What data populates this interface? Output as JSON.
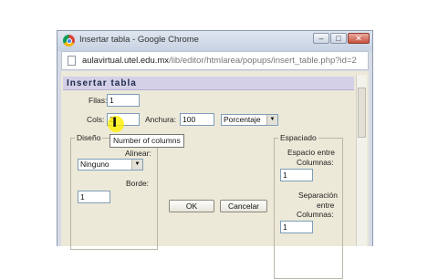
{
  "window": {
    "title": "Insertar tabla - Google Chrome",
    "buttons": {
      "minimize": "–",
      "maximize": "□",
      "close": "✕"
    }
  },
  "address_bar": {
    "host": "aulavirtual.utel.edu.mx",
    "path": "/lib/editor/htmlarea/popups/insert_table.php?id=2"
  },
  "dialog": {
    "title": "Insertar tabla",
    "rows_label": "Filas:",
    "rows_value": "1",
    "cols_label": "Cols:",
    "cols_value": "2",
    "width_label": "Anchura:",
    "width_value": "100",
    "width_unit": "Porcentaje",
    "tooltip": "Number of columns",
    "layout": {
      "legend": "Diseño",
      "align_label": "Alinear:",
      "align_value": "Ninguno",
      "border_label": "Borde:",
      "border_value": "1"
    },
    "spacing": {
      "legend": "Espaciado",
      "cell_spacing_label_1": "Espacio entre",
      "cell_spacing_label_2": "Columnas:",
      "cell_spacing_value": "1",
      "cell_padding_label_1": "Separación",
      "cell_padding_label_2": "entre",
      "cell_padding_label_3": "Columnas:",
      "cell_padding_value": "1"
    },
    "ok_label": "OK",
    "cancel_label": "Cancelar"
  }
}
